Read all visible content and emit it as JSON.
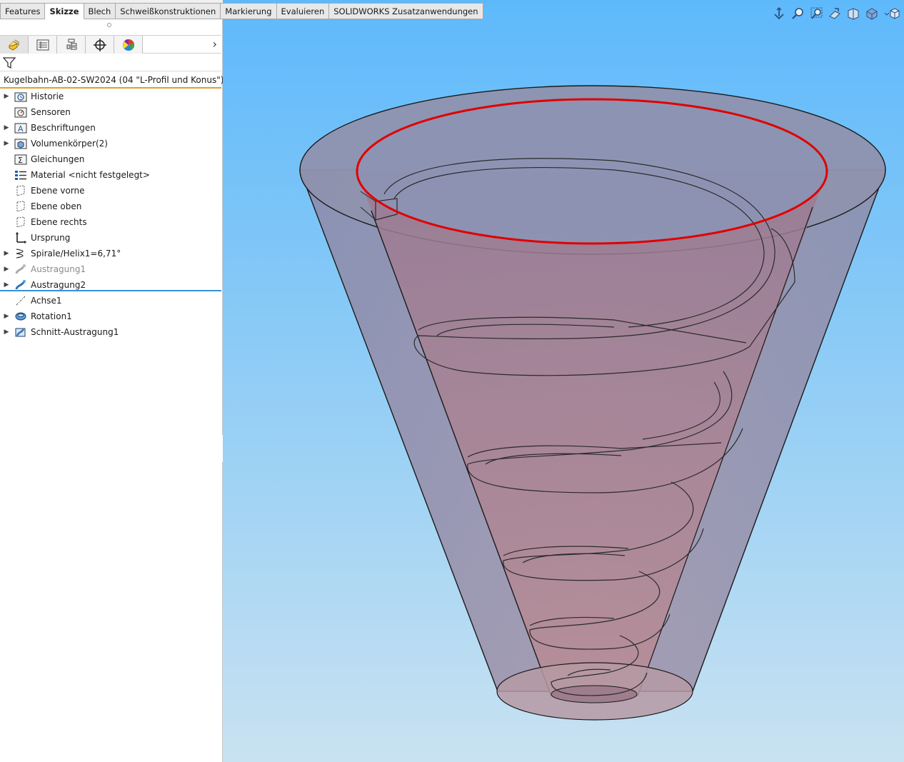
{
  "command_tabs": [
    "Features",
    "Skizze",
    "Blech",
    "Schweißkonstruktionen",
    "Markierung",
    "Evaluieren",
    "SOLIDWORKS Zusatzanwendungen"
  ],
  "active_tab": "Skizze",
  "feature_manager": {
    "panel_tabs": [
      {
        "name": "featuremanager-tab",
        "icon": "feature-manager-icon"
      },
      {
        "name": "propertymanager-tab",
        "icon": "property-manager-icon"
      },
      {
        "name": "configurationmanager-tab",
        "icon": "configuration-manager-icon"
      },
      {
        "name": "dimxpertmanager-tab",
        "icon": "dimxpert-icon"
      },
      {
        "name": "displaymanager-tab",
        "icon": "display-manager-icon"
      }
    ],
    "filter_placeholder": "",
    "root": "Kugelbahn-AB-02-SW2024  (04 \"L-Profil und Konus\")",
    "items": [
      {
        "label": "Historie",
        "icon": "history-folder-icon",
        "expandable": true
      },
      {
        "label": "Sensoren",
        "icon": "sensor-icon",
        "expandable": false
      },
      {
        "label": "Beschriftungen",
        "icon": "annotations-icon",
        "expandable": true
      },
      {
        "label": "Volumenkörper(2)",
        "icon": "solid-bodies-icon",
        "expandable": true
      },
      {
        "label": "Gleichungen",
        "icon": "equations-icon",
        "expandable": false
      },
      {
        "label": "Material <nicht festgelegt>",
        "icon": "material-icon",
        "expandable": false
      },
      {
        "label": "Ebene vorne",
        "icon": "plane-icon",
        "expandable": false
      },
      {
        "label": "Ebene oben",
        "icon": "plane-icon",
        "expandable": false
      },
      {
        "label": "Ebene rechts",
        "icon": "plane-icon",
        "expandable": false
      },
      {
        "label": "Ursprung",
        "icon": "origin-icon",
        "expandable": false
      },
      {
        "label": "Spirale/Helix1=6,71°",
        "icon": "helix-icon",
        "expandable": true
      },
      {
        "label": "Austragung1",
        "icon": "sweep-icon",
        "expandable": true,
        "suppressed": true
      },
      {
        "label": "Austragung2",
        "icon": "sweep-icon",
        "expandable": true
      },
      {
        "label": "Achse1",
        "icon": "axis-icon",
        "expandable": false
      },
      {
        "label": "Rotation1",
        "icon": "revolve-icon",
        "expandable": true
      },
      {
        "label": "Schnitt-Austragung1",
        "icon": "swept-cut-icon",
        "expandable": true
      }
    ]
  },
  "heads_up_toolbar": [
    "view-orientation-icon",
    "zoom-to-fit-icon",
    "zoom-to-area-icon",
    "previous-view-icon",
    "section-view-icon",
    "display-style-icon",
    "view-settings-icon"
  ],
  "colors": {
    "viewport_top": "#5eb9fb",
    "viewport_bottom": "#c9e2f1",
    "cone_fill": "#9a8aa3",
    "inner_fill": "#a97f8d",
    "highlight_edge": "#e00000"
  }
}
